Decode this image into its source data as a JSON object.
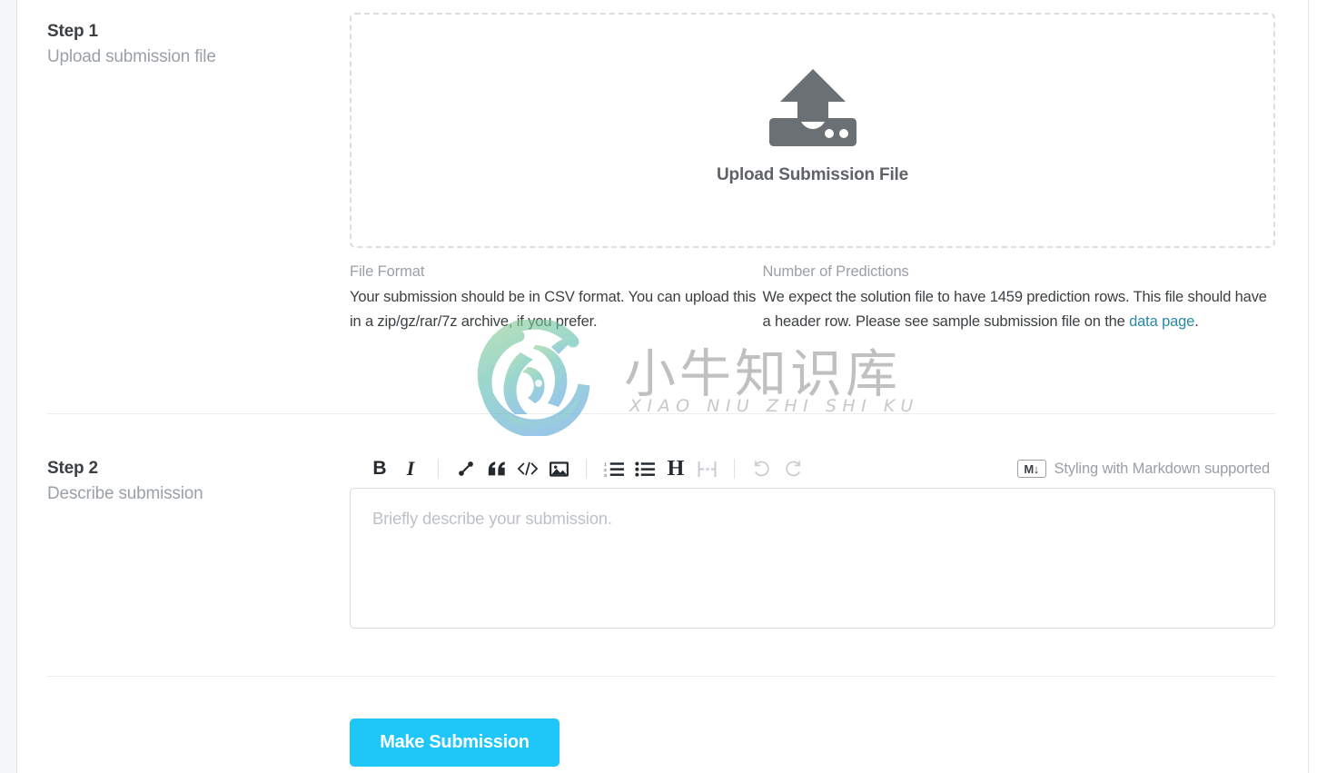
{
  "step1": {
    "title": "Step 1",
    "subtitle": "Upload submission file",
    "dropzone": {
      "caption": "Upload Submission File",
      "icon": "upload-icon"
    },
    "info": [
      {
        "heading": "File Format",
        "body": "Your submission should be in CSV format. You can upload this in a zip/gz/rar/7z archive, if you prefer."
      },
      {
        "heading": "Number of Predictions",
        "body_before": "We expect the solution file to have 1459 prediction rows. This file should have a header row. Please see sample submission file on the ",
        "link_text": "data page",
        "body_after": "."
      }
    ]
  },
  "step2": {
    "title": "Step 2",
    "subtitle": "Describe submission",
    "toolbar": {
      "bold": "B",
      "italic": "I",
      "heading": "H",
      "markdown_badge": "M",
      "markdown_note": "Styling with Markdown supported"
    },
    "textarea": {
      "placeholder": "Briefly describe your submission.",
      "value": ""
    }
  },
  "submit": {
    "label": "Make Submission"
  },
  "watermark": {
    "chinese": "小牛知识库",
    "pinyin": "XIAO NIU ZHI SHI KU"
  },
  "colors": {
    "accent": "#1ec7f7",
    "link": "#2b88a6",
    "muted_text": "#9aa0a6",
    "body_text": "#3c4043",
    "dropzone_border": "#dddddd"
  }
}
